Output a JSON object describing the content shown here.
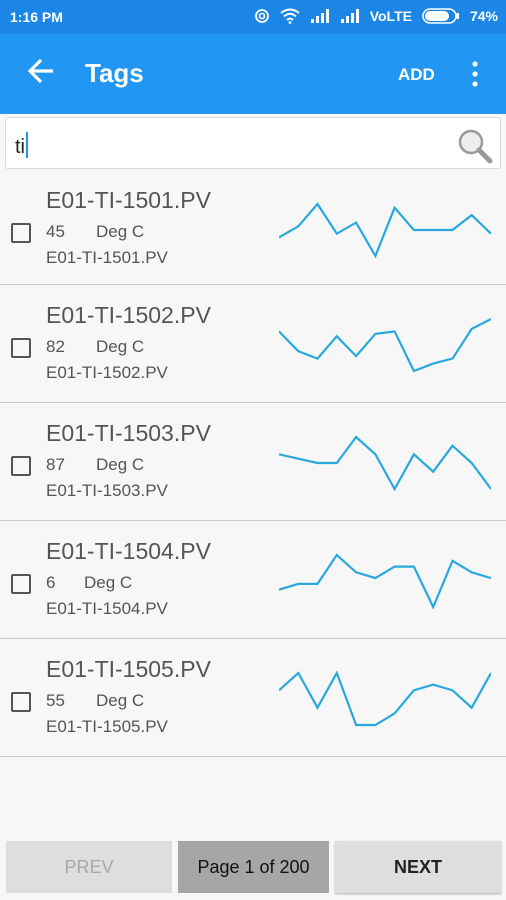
{
  "status_bar": {
    "time": "1:16 PM",
    "network": "VoLTE",
    "battery": "74%"
  },
  "app_bar": {
    "title": "Tags",
    "add_label": "ADD"
  },
  "search": {
    "value": "ti"
  },
  "colors": {
    "primary": "#2196f3",
    "status_bar": "#1c86e6",
    "sparkline": "#29a8dd"
  },
  "tags": [
    {
      "title": "E01-TI-1501.PV",
      "value": "45",
      "unit": "Deg C",
      "subtitle": "E01-TI-1501.PV",
      "trend": [
        44,
        47,
        53,
        45,
        48,
        39,
        52,
        46,
        46,
        46,
        50,
        45
      ]
    },
    {
      "title": "E01-TI-1502.PV",
      "value": "82",
      "unit": "Deg C",
      "subtitle": "E01-TI-1502.PV",
      "trend": [
        84,
        76,
        73,
        82,
        74,
        83,
        84,
        68,
        71,
        73,
        85,
        89
      ]
    },
    {
      "title": "E01-TI-1503.PV",
      "value": "87",
      "unit": "Deg C",
      "subtitle": "E01-TI-1503.PV",
      "trend": [
        88,
        87,
        86,
        86,
        92,
        88,
        80,
        88,
        84,
        90,
        86,
        80
      ]
    },
    {
      "title": "E01-TI-1504.PV",
      "value": "6",
      "unit": "Deg C",
      "subtitle": "E01-TI-1504.PV",
      "trend": [
        4,
        5,
        5,
        10,
        7,
        6,
        8,
        8,
        1,
        9,
        7,
        6
      ]
    },
    {
      "title": "E01-TI-1505.PV",
      "value": "55",
      "unit": "Deg C",
      "subtitle": "E01-TI-1505.PV",
      "trend": [
        56,
        59,
        53,
        59,
        50,
        50,
        52,
        56,
        57,
        56,
        53,
        59
      ]
    }
  ],
  "pagination": {
    "prev_label": "PREV",
    "page_label": "Page 1 of 200",
    "next_label": "NEXT"
  }
}
